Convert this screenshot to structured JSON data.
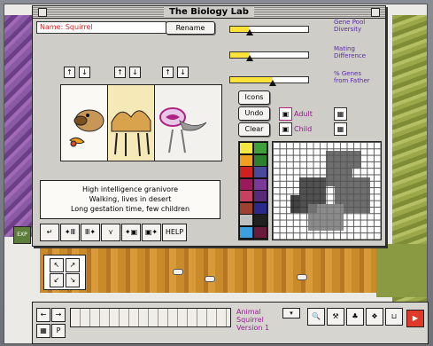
{
  "window": {
    "title": "The Biology Lab"
  },
  "name_field": {
    "label": "Name: Squirrel"
  },
  "buttons": {
    "rename": "Rename",
    "icons": "Icons",
    "undo": "Undo",
    "clear": "Clear"
  },
  "sliders": [
    {
      "label_line1": "Gene Pool",
      "label_line2": "Diversity",
      "value": 0.25
    },
    {
      "label_line1": "Mating",
      "label_line2": "Difference",
      "value": 0.25
    },
    {
      "label_line1": "% Genes",
      "label_line2": "from Father",
      "value": 0.55
    }
  ],
  "body_part_arrows": [
    "↑",
    "↓",
    "↑",
    "↓",
    "↑",
    "↓"
  ],
  "stages": {
    "adult": "Adult",
    "child": "Child"
  },
  "description": {
    "line1": "High intelligence granivore",
    "line2": "Walking, lives in desert",
    "line3": "Long gestation time, few children"
  },
  "tools": [
    "↵",
    "✦Ⅲ",
    "Ⅲ✦",
    "⋎",
    "✦▣",
    "▣✦",
    "HELP"
  ],
  "palette_colors": [
    "#f5e642",
    "#3f9f3a",
    "#f0a020",
    "#2e7f2e",
    "#d02020",
    "#4a4a9a",
    "#9a1a5a",
    "#7a3a9a",
    "#c84060",
    "#5a2a7a",
    "#a04030",
    "#2a2a8a",
    "#c0c0c0",
    "#202020",
    "#3aa0e0",
    "#6a1a3a"
  ],
  "bottom": {
    "animal_label": "Animal",
    "animal_name": "Squirrel",
    "version": "Version 1"
  },
  "side_icon_label": "EXP"
}
